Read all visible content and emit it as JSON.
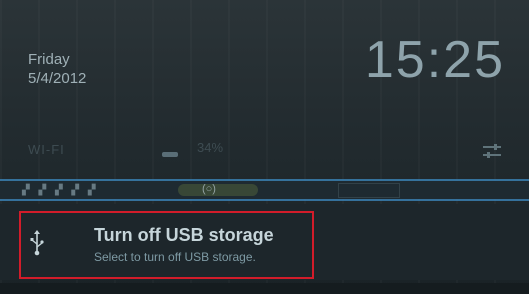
{
  "header": {
    "day": "Friday",
    "date": "5/4/2012",
    "time": "15:25"
  },
  "quick_settings": {
    "wifi_label": "WI-FI",
    "brightness_label": "34%",
    "settings_icon": "settings-sliders-icon"
  },
  "notification": {
    "icon": "usb-icon",
    "title": "Turn off USB storage",
    "subtitle": "Select to turn off USB storage."
  },
  "colors": {
    "accent": "#3a7fb0",
    "highlight": "#d21c2a"
  }
}
